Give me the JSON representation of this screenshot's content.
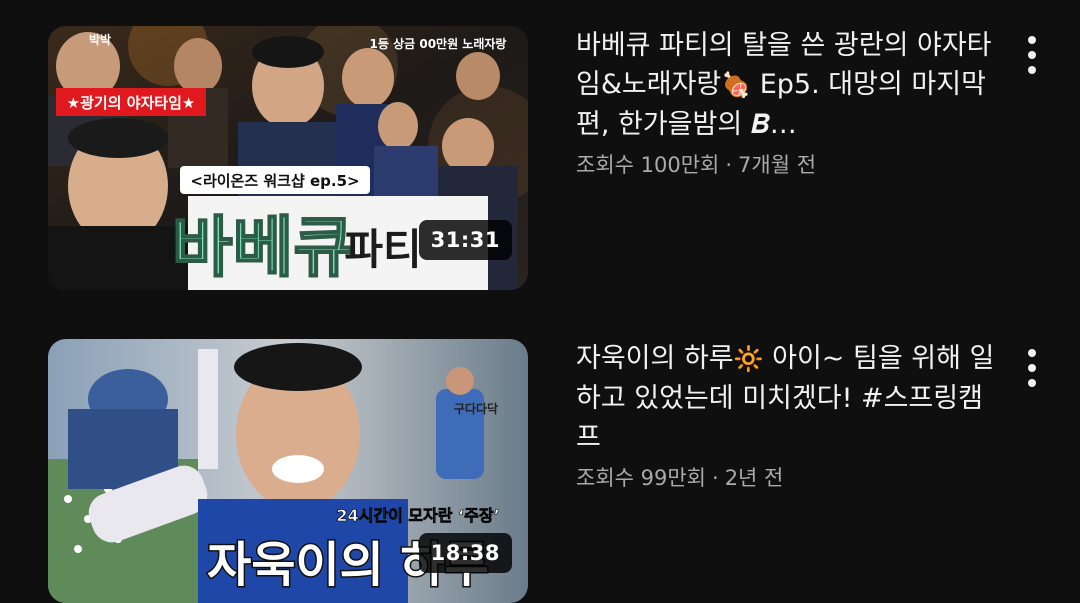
{
  "videos": [
    {
      "title_parts": [
        "바베큐 파티의 탈을 쓴 광란의 야자타임&노래자랑",
        " Ep5. 대망의 마지막편, 한가을밤의 𝑩…"
      ],
      "title_emoji": "🍖",
      "views": "조회수 100만회",
      "separator": "·",
      "age": "7개월 전",
      "duration": "31:31",
      "thumb_text": {
        "top_right": "1등 상금 00만원 노래자랑",
        "top_left": "박박",
        "red_banner": "★광기의 야자타임★",
        "sub_banner": "<라이온즈 워크샵 ep.5>",
        "big_main": "바베큐",
        "big_sub": "파티"
      },
      "more_icon": "three-dots-vertical"
    },
    {
      "title_parts": [
        "자욱이의 하루",
        " 아이~ 팀을 위해 일하고 있었는데 미치겠다! #스프링캠프"
      ],
      "title_emoji": "🔆",
      "views": "조회수 99만회",
      "separator": "·",
      "age": "2년 전",
      "duration": "18:38",
      "thumb_text": {
        "caption": "구다다닥",
        "sub_banner": "24시간이 모자란 ‘주장’",
        "big_main": "자욱이의 하루"
      },
      "more_icon": "three-dots-vertical"
    }
  ],
  "colors": {
    "background": "#0f0f0f",
    "title": "#f1f1f1",
    "meta": "#aaaaaa",
    "accent_green": "#7fe0b4",
    "banner_red": "#e0191e"
  }
}
